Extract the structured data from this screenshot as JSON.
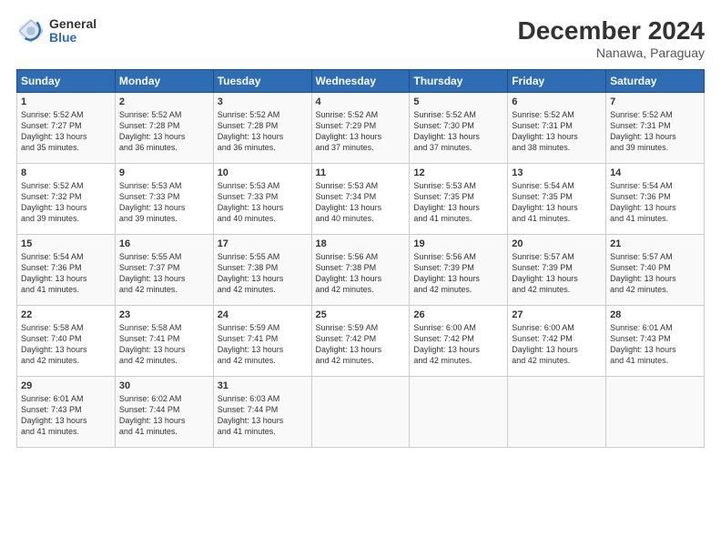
{
  "logo": {
    "general": "General",
    "blue": "Blue"
  },
  "title": "December 2024",
  "subtitle": "Nanawa, Paraguay",
  "weekdays": [
    "Sunday",
    "Monday",
    "Tuesday",
    "Wednesday",
    "Thursday",
    "Friday",
    "Saturday"
  ],
  "weeks": [
    [
      {
        "day": "1",
        "info": "Sunrise: 5:52 AM\nSunset: 7:27 PM\nDaylight: 13 hours\nand 35 minutes."
      },
      {
        "day": "2",
        "info": "Sunrise: 5:52 AM\nSunset: 7:28 PM\nDaylight: 13 hours\nand 36 minutes."
      },
      {
        "day": "3",
        "info": "Sunrise: 5:52 AM\nSunset: 7:28 PM\nDaylight: 13 hours\nand 36 minutes."
      },
      {
        "day": "4",
        "info": "Sunrise: 5:52 AM\nSunset: 7:29 PM\nDaylight: 13 hours\nand 37 minutes."
      },
      {
        "day": "5",
        "info": "Sunrise: 5:52 AM\nSunset: 7:30 PM\nDaylight: 13 hours\nand 37 minutes."
      },
      {
        "day": "6",
        "info": "Sunrise: 5:52 AM\nSunset: 7:31 PM\nDaylight: 13 hours\nand 38 minutes."
      },
      {
        "day": "7",
        "info": "Sunrise: 5:52 AM\nSunset: 7:31 PM\nDaylight: 13 hours\nand 39 minutes."
      }
    ],
    [
      {
        "day": "8",
        "info": "Sunrise: 5:52 AM\nSunset: 7:32 PM\nDaylight: 13 hours\nand 39 minutes."
      },
      {
        "day": "9",
        "info": "Sunrise: 5:53 AM\nSunset: 7:33 PM\nDaylight: 13 hours\nand 39 minutes."
      },
      {
        "day": "10",
        "info": "Sunrise: 5:53 AM\nSunset: 7:33 PM\nDaylight: 13 hours\nand 40 minutes."
      },
      {
        "day": "11",
        "info": "Sunrise: 5:53 AM\nSunset: 7:34 PM\nDaylight: 13 hours\nand 40 minutes."
      },
      {
        "day": "12",
        "info": "Sunrise: 5:53 AM\nSunset: 7:35 PM\nDaylight: 13 hours\nand 41 minutes."
      },
      {
        "day": "13",
        "info": "Sunrise: 5:54 AM\nSunset: 7:35 PM\nDaylight: 13 hours\nand 41 minutes."
      },
      {
        "day": "14",
        "info": "Sunrise: 5:54 AM\nSunset: 7:36 PM\nDaylight: 13 hours\nand 41 minutes."
      }
    ],
    [
      {
        "day": "15",
        "info": "Sunrise: 5:54 AM\nSunset: 7:36 PM\nDaylight: 13 hours\nand 41 minutes."
      },
      {
        "day": "16",
        "info": "Sunrise: 5:55 AM\nSunset: 7:37 PM\nDaylight: 13 hours\nand 42 minutes."
      },
      {
        "day": "17",
        "info": "Sunrise: 5:55 AM\nSunset: 7:38 PM\nDaylight: 13 hours\nand 42 minutes."
      },
      {
        "day": "18",
        "info": "Sunrise: 5:56 AM\nSunset: 7:38 PM\nDaylight: 13 hours\nand 42 minutes."
      },
      {
        "day": "19",
        "info": "Sunrise: 5:56 AM\nSunset: 7:39 PM\nDaylight: 13 hours\nand 42 minutes."
      },
      {
        "day": "20",
        "info": "Sunrise: 5:57 AM\nSunset: 7:39 PM\nDaylight: 13 hours\nand 42 minutes."
      },
      {
        "day": "21",
        "info": "Sunrise: 5:57 AM\nSunset: 7:40 PM\nDaylight: 13 hours\nand 42 minutes."
      }
    ],
    [
      {
        "day": "22",
        "info": "Sunrise: 5:58 AM\nSunset: 7:40 PM\nDaylight: 13 hours\nand 42 minutes."
      },
      {
        "day": "23",
        "info": "Sunrise: 5:58 AM\nSunset: 7:41 PM\nDaylight: 13 hours\nand 42 minutes."
      },
      {
        "day": "24",
        "info": "Sunrise: 5:59 AM\nSunset: 7:41 PM\nDaylight: 13 hours\nand 42 minutes."
      },
      {
        "day": "25",
        "info": "Sunrise: 5:59 AM\nSunset: 7:42 PM\nDaylight: 13 hours\nand 42 minutes."
      },
      {
        "day": "26",
        "info": "Sunrise: 6:00 AM\nSunset: 7:42 PM\nDaylight: 13 hours\nand 42 minutes."
      },
      {
        "day": "27",
        "info": "Sunrise: 6:00 AM\nSunset: 7:42 PM\nDaylight: 13 hours\nand 42 minutes."
      },
      {
        "day": "28",
        "info": "Sunrise: 6:01 AM\nSunset: 7:43 PM\nDaylight: 13 hours\nand 41 minutes."
      }
    ],
    [
      {
        "day": "29",
        "info": "Sunrise: 6:01 AM\nSunset: 7:43 PM\nDaylight: 13 hours\nand 41 minutes."
      },
      {
        "day": "30",
        "info": "Sunrise: 6:02 AM\nSunset: 7:44 PM\nDaylight: 13 hours\nand 41 minutes."
      },
      {
        "day": "31",
        "info": "Sunrise: 6:03 AM\nSunset: 7:44 PM\nDaylight: 13 hours\nand 41 minutes."
      },
      null,
      null,
      null,
      null
    ]
  ]
}
